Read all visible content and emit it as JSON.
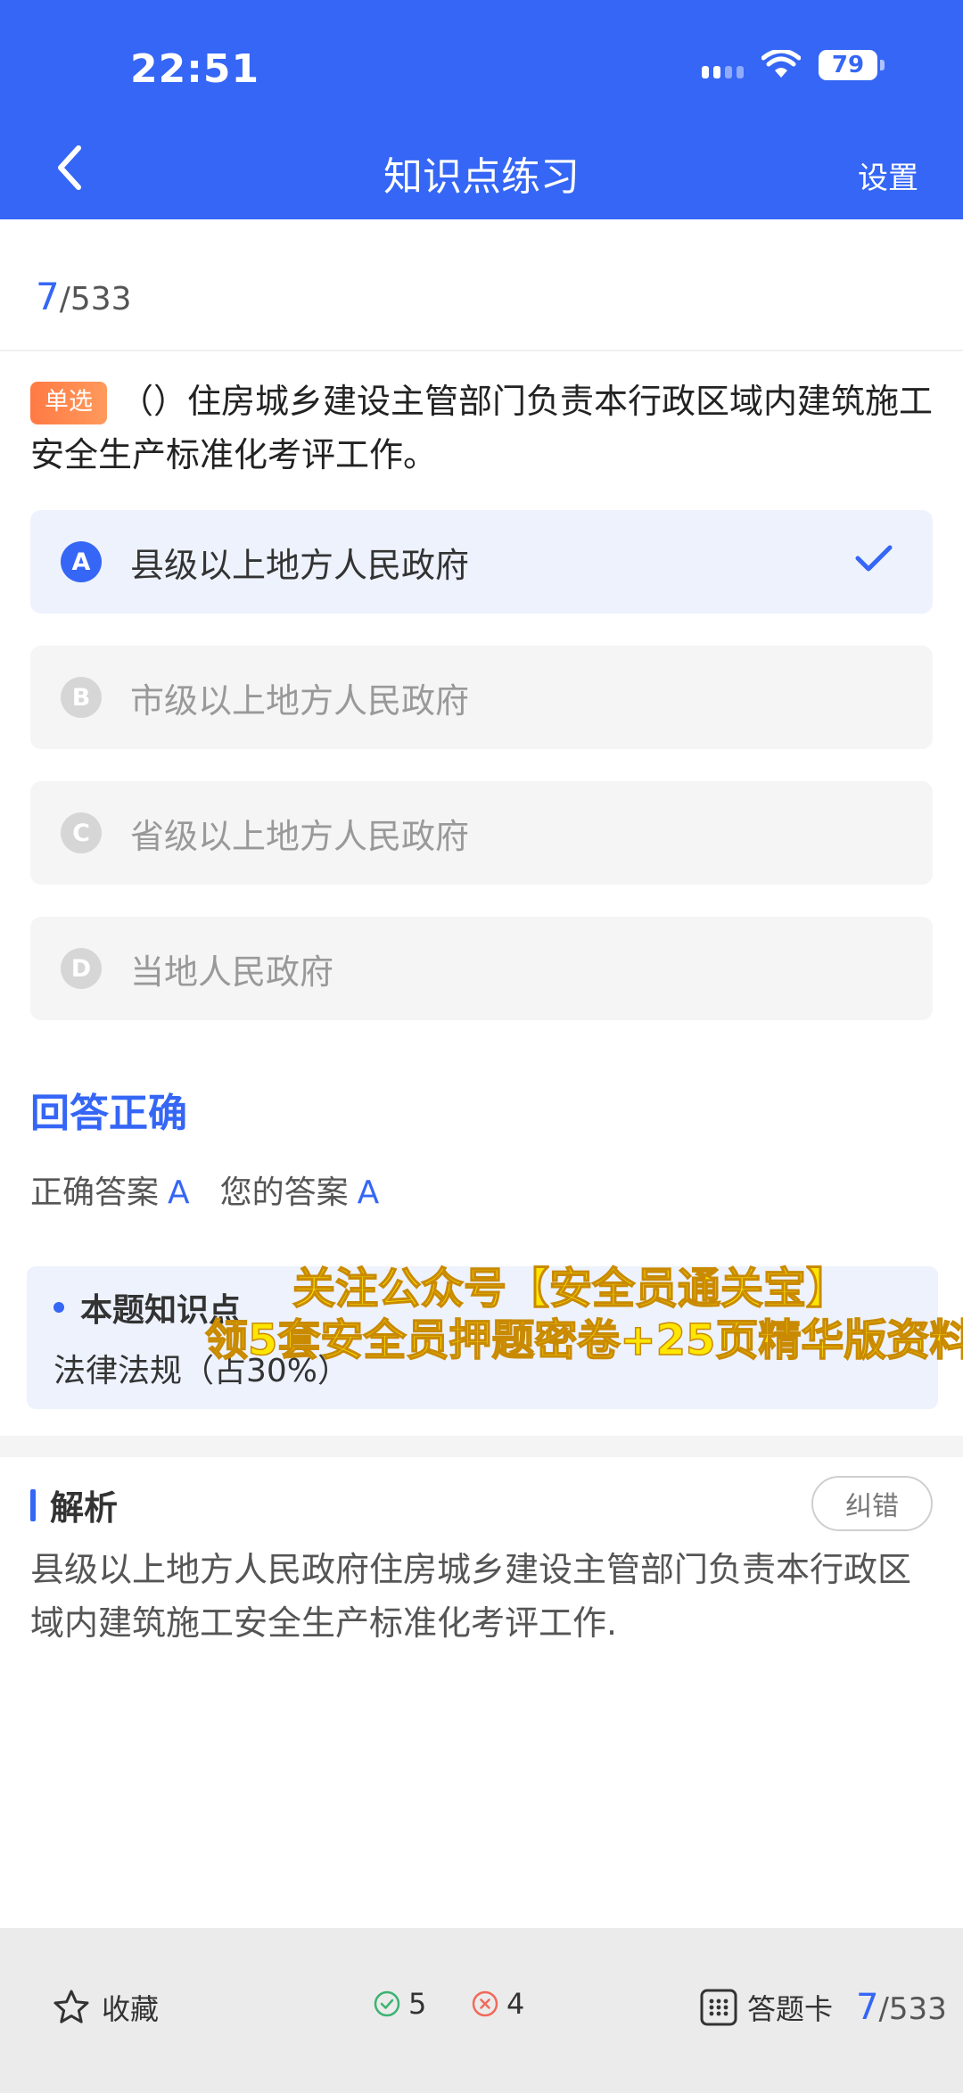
{
  "status": {
    "time": "22:51",
    "battery": "79"
  },
  "nav": {
    "title": "知识点练习",
    "settings": "设置"
  },
  "progress": {
    "current": "7",
    "total": "/533"
  },
  "question": {
    "type_badge": "单选",
    "text": "（）住房城乡建设主管部门负责本行政区域内建筑施工安全生产标准化考评工作。"
  },
  "options": [
    {
      "letter": "A",
      "text": "县级以上地方人民政府",
      "selected": true
    },
    {
      "letter": "B",
      "text": "市级以上地方人民政府",
      "selected": false
    },
    {
      "letter": "C",
      "text": "省级以上地方人民政府",
      "selected": false
    },
    {
      "letter": "D",
      "text": "当地人民政府",
      "selected": false
    }
  ],
  "result": {
    "title": "回答正确",
    "correct_label": "正确答案",
    "correct_value": "A",
    "your_label": "您的答案",
    "your_value": "A"
  },
  "knowledge": {
    "title": "本题知识点",
    "value": "法律法规（占30%）"
  },
  "overlay": {
    "line1": "关注公众号【安全员通关宝】",
    "line2": "领5套安全员押题密卷+25页精华版资料"
  },
  "analysis": {
    "title": "解析",
    "report_button": "纠错",
    "text": "县级以上地方人民政府住房城乡建设主管部门负责本行政区域内建筑施工安全生产标准化考评工作."
  },
  "bottom": {
    "favorite": "收藏",
    "correct_count": "5",
    "wrong_count": "4",
    "answer_card": "答题卡",
    "page_current": "7",
    "page_total": "/533"
  },
  "colors": {
    "accent": "#3566f5",
    "badge": "#ff7a45",
    "overlay_text": "#ffe600"
  }
}
